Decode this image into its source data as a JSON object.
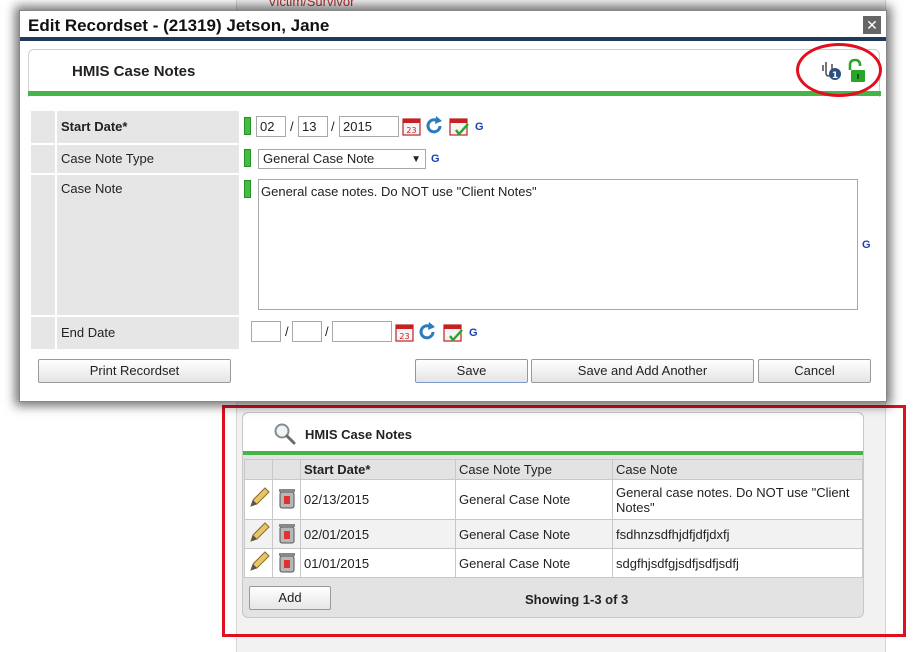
{
  "background": {
    "top_fragment": "Victim/Survivor"
  },
  "dialog": {
    "title": "Edit Recordset - (21319) Jetson, Jane",
    "close_symbol": "✕",
    "section_title": "HMIS Case Notes",
    "form": {
      "start_date": {
        "label": "Start Date",
        "required_mark": "*",
        "month": "02",
        "day": "13",
        "year": "2015",
        "g": "G"
      },
      "case_note_type": {
        "label": "Case Note Type",
        "value": "General Case Note",
        "g": "G"
      },
      "case_note": {
        "label": "Case Note",
        "value": "General case notes. Do NOT use \"Client Notes\"",
        "g": "G"
      },
      "end_date": {
        "label": "End Date",
        "month": "",
        "day": "",
        "year": "",
        "g": "G"
      }
    },
    "buttons": {
      "print": "Print Recordset",
      "save": "Save",
      "save_add": "Save and Add Another",
      "cancel": "Cancel"
    },
    "icons": [
      "clip-info-icon",
      "unlock-icon",
      "calendar-icon",
      "refresh-icon",
      "calendar-check-icon"
    ]
  },
  "list_panel": {
    "title": "HMIS Case Notes",
    "columns": [
      "Start Date",
      "Case Note Type",
      "Case Note"
    ],
    "required_mark": "*",
    "rows": [
      {
        "start_date": "02/13/2015",
        "type": "General Case Note",
        "note": "General case notes. Do NOT use \"Client Notes\""
      },
      {
        "start_date": "02/01/2015",
        "type": "General Case Note",
        "note": "fsdhnzsdfhjdfjdfjdxfj"
      },
      {
        "start_date": "01/01/2015",
        "type": "General Case Note",
        "note": "sdgfhjsdfgjsdfjsdfjsdfj"
      }
    ],
    "add_button": "Add",
    "showing": "Showing 1-3 of 3"
  },
  "colors": {
    "accent_green": "#46b446",
    "title_rule": "#1f3a5a",
    "highlight_red": "#e0101e"
  }
}
